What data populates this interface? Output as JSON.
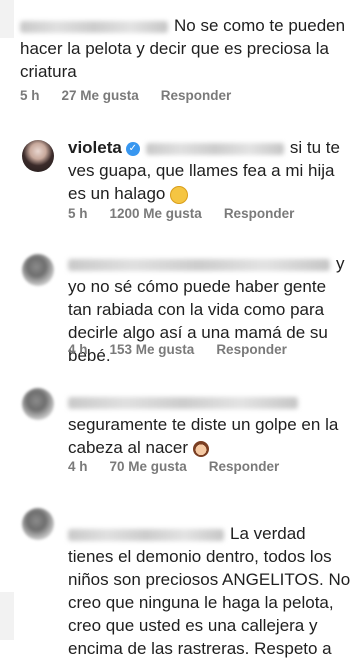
{
  "comments": [
    {
      "text": "No se como te pueden hacer la pelota y decir que es preciosa la criatura",
      "time": "5 h",
      "likes": "27 Me gusta",
      "reply": "Responder"
    },
    {
      "username": "violeta",
      "text": "si tu te ves guapa, que llames fea a mi hija es un halago",
      "time": "5 h",
      "likes": "1200 Me gusta",
      "reply": "Responder"
    },
    {
      "text": "y yo no sé cómo puede haber gente tan rabiada con la vida como para decirle algo así a una mamá de su bebé.",
      "time": "4 h",
      "likes": "153 Me gusta",
      "reply": "Responder"
    },
    {
      "text": "seguramente te diste un golpe en la cabeza al nacer",
      "time": "4 h",
      "likes": "70 Me gusta",
      "reply": "Responder"
    },
    {
      "text": "La verdad tienes el demonio dentro, todos los niños son preciosos ANGELITOS. No creo que ninguna le haga la pelota, creo que usted es una callejera y encima de las rastreras. Respeto a"
    }
  ],
  "colors": {
    "text": "#1f1f1f",
    "meta": "#7a7a7a",
    "verified": "#3897f0"
  },
  "icons": [
    "verified-icon",
    "smile-emoji-icon",
    "woman-emoji-icon"
  ]
}
